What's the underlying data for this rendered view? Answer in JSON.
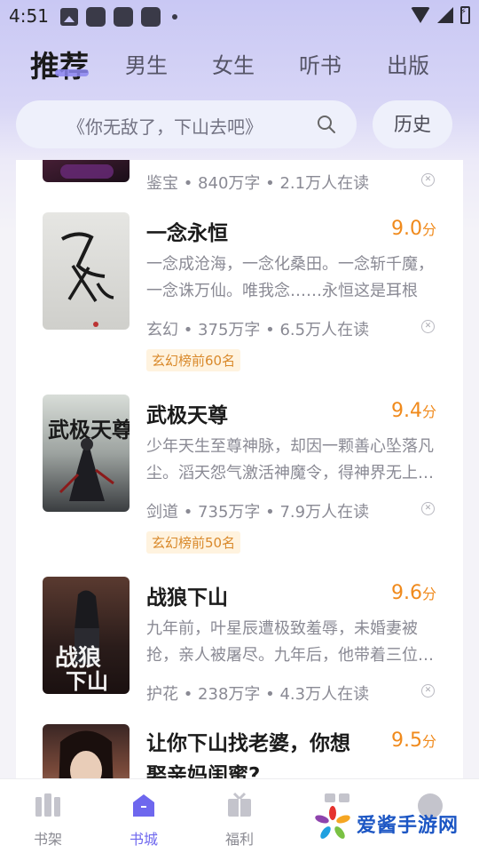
{
  "status_bar": {
    "time": "4:51"
  },
  "tabs": [
    {
      "label": "推荐",
      "active": true
    },
    {
      "label": "男生",
      "active": false
    },
    {
      "label": "女生",
      "active": false
    },
    {
      "label": "听书",
      "active": false
    },
    {
      "label": "出版",
      "active": false
    }
  ],
  "search": {
    "placeholder": "《你无敌了，下山去吧》"
  },
  "history_button": "历史",
  "books": [
    {
      "title": "",
      "score": "",
      "score_unit": "",
      "desc": "",
      "meta": "鉴宝 • 840万字 • 2.1万人在读",
      "badge": ""
    },
    {
      "title": "一念永恒",
      "score": "9.0",
      "score_unit": "分",
      "desc": "一念成沧海，一念化桑田。一念斩千魔，一念诛万仙。唯我念……永恒这是耳根继…",
      "meta": "玄幻 • 375万字 • 6.5万人在读",
      "badge": "玄幻榜前60名"
    },
    {
      "title": "武极天尊",
      "score": "9.4",
      "score_unit": "分",
      "desc": "少年天生至尊神脉，却因一颗善心坠落凡尘。滔天怨气激活神魔令，得神界无上…",
      "meta": "剑道 • 735万字 • 7.9万人在读",
      "badge": "玄幻榜前50名"
    },
    {
      "title": "战狼下山",
      "score": "9.6",
      "score_unit": "分",
      "desc": "九年前，叶星辰遭极致羞辱，未婚妻被抢，亲人被屠尽。九年后，他带着三位…",
      "meta": "护花 • 238万字 • 4.3万人在读",
      "badge": ""
    },
    {
      "title": "让你下山找老婆，你想娶亲妈闺蜜?",
      "score": "9.5",
      "score_unit": "分",
      "desc": "",
      "meta": "",
      "badge": ""
    }
  ],
  "bottom_nav": [
    {
      "label": "书架",
      "icon": "bookshelf-icon",
      "active": false
    },
    {
      "label": "书城",
      "icon": "store-icon",
      "active": true
    },
    {
      "label": "福利",
      "icon": "gift-icon",
      "active": false
    },
    {
      "label": "",
      "icon": "grid-icon",
      "active": false
    },
    {
      "label": "",
      "icon": "profile-icon",
      "active": false
    }
  ],
  "watermark": {
    "text": "爱酱手游网"
  },
  "colors": {
    "accent": "#6e67ee",
    "score": "#f08a1c",
    "badge_text": "#d9892b",
    "badge_bg": "#fff3df"
  }
}
